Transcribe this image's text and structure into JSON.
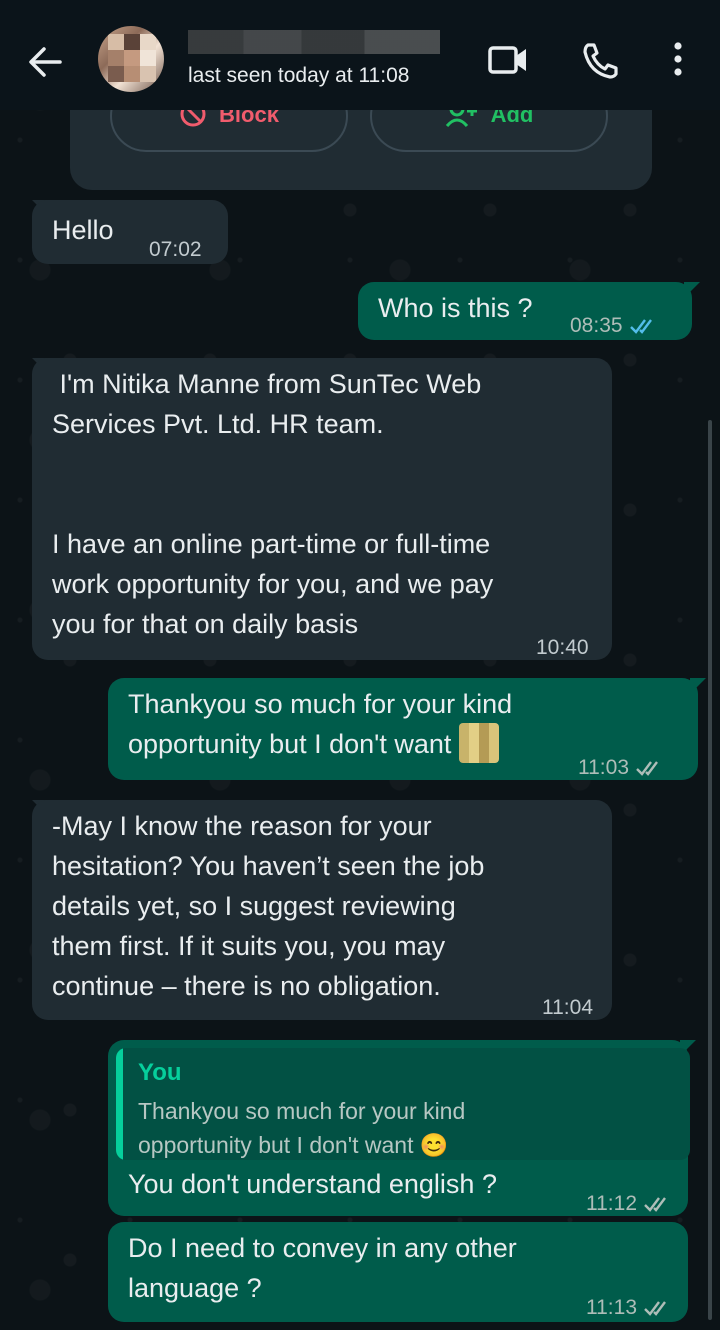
{
  "header": {
    "last_seen": "last seen today at 11:08",
    "icons": [
      "back-arrow-icon",
      "video-call-icon",
      "phone-icon",
      "more-options-icon"
    ]
  },
  "contact_card": {
    "block_label": "Block",
    "add_label": "Add"
  },
  "messages": [
    {
      "dir": "in",
      "text": "Hello",
      "time": "07:02"
    },
    {
      "dir": "out",
      "text": "Who is this ?",
      "time": "08:35",
      "status": "read"
    },
    {
      "dir": "in",
      "text": " I'm Nitika Manne from SunTec Web\nServices Pvt. Ltd. HR team.\n\n\nI have an online part-time or full-time\nwork opportunity for you, and we pay\nyou for that on daily basis",
      "time": "10:40"
    },
    {
      "dir": "out",
      "text": "Thankyou so much for your kind\nopportunity but I don't want",
      "time": "11:03",
      "status": "delivered"
    },
    {
      "dir": "in",
      "text": "-May I know the reason for your\nhesitation? You haven’t seen the job\ndetails yet, so I suggest reviewing\nthem first. If it suits you, you may\ncontinue – there is no obligation.",
      "time": "11:04"
    },
    {
      "dir": "out",
      "quote_author": "You",
      "quote_text": "Thankyou so much for your kind\nopportunity but I don't want 😊",
      "text": "You don't understand english ?",
      "time": "11:12",
      "status": "delivered"
    },
    {
      "dir": "out",
      "text": "Do I need to convey in any other\nlanguage ?",
      "time": "11:13",
      "status": "delivered"
    }
  ],
  "colors": {
    "background": "#0b141a",
    "incoming_bubble": "#202c33",
    "outgoing_bubble": "#005c4b",
    "read_tick": "#53bdeb",
    "quote_accent": "#06cf9c",
    "block_red": "#f15c6d",
    "add_green": "#21c063"
  }
}
